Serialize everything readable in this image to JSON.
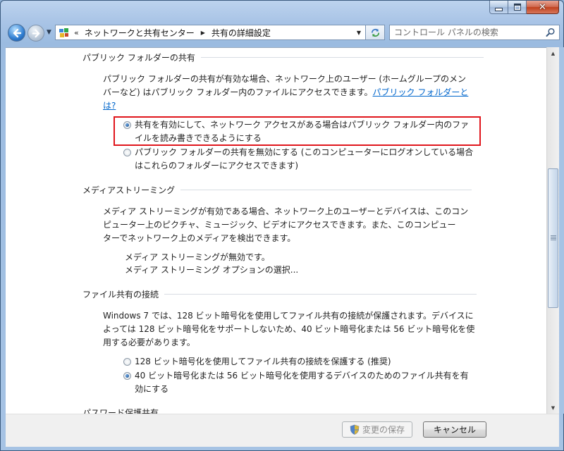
{
  "toolbar": {
    "history_chevron": "«",
    "breadcrumb": [
      "ネットワークと共有センター",
      "共有の詳細設定"
    ],
    "search_placeholder": "コントロール パネルの検索"
  },
  "icons": {
    "back": "back-arrow-icon",
    "forward": "forward-arrow-icon",
    "refresh": "refresh-icon",
    "search": "search-icon",
    "control_panel": "control-panel-icon",
    "shield": "uac-shield-icon"
  },
  "colors": {
    "link": "#0066cc",
    "highlight_border": "#e0161c"
  },
  "public_folder": {
    "title": "パブリック フォルダーの共有",
    "desc_line1": "パブリック フォルダーの共有が有効な場合、ネットワーク上のユーザー (ホームグループのメン",
    "desc_line2": "バーなど) はパブリック フォルダー内のファイルにアクセスできます。",
    "link_part1": "パブリック フォルダーと",
    "link_part2": "は?",
    "option_on_line1": "共有を有効にして、ネットワーク アクセスがある場合はパブリック フォルダー内のファ",
    "option_on_line2": "イルを読み書きできるようにする",
    "option_off_line1": "パブリック フォルダーの共有を無効にする (このコンピューターにログオンしている場合",
    "option_off_line2": "はこれらのフォルダーにアクセスできます)"
  },
  "media": {
    "title": "メディアストリーミング",
    "desc_line1": "メディア ストリーミングが有効である場合、ネットワーク上のユーザーとデバイスは、このコン",
    "desc_line2": "ピューター上のピクチャ、ミュージック、ビデオにアクセスできます。また、このコンピュー",
    "desc_line3": "ターでネットワーク上のメディアを検出できます。",
    "status": "メディア ストリーミングが無効です。",
    "options_link": "メディア ストリーミング オプションの選択..."
  },
  "file_sharing": {
    "title": "ファイル共有の接続",
    "desc_line1": "Windows 7 では、128 ビット暗号化を使用してファイル共有の接続が保護されます。デバイスに",
    "desc_line2": "よっては 128 ビット暗号化をサポートしないため、40 ビット暗号化または 56 ビット暗号化を使",
    "desc_line3": "用する必要があります。",
    "option_128": "128 ビット暗号化を使用してファイル共有の接続を保護する (推奨)",
    "option_40_line1": "40 ビット暗号化または 56 ビット暗号化を使用するデバイスのためのファイル共有を有",
    "option_40_line2": "効にする"
  },
  "password": {
    "title_partial": "パスワード保護共有"
  },
  "footer": {
    "save_label": "変更の保存",
    "cancel_label": "キャンセル"
  }
}
